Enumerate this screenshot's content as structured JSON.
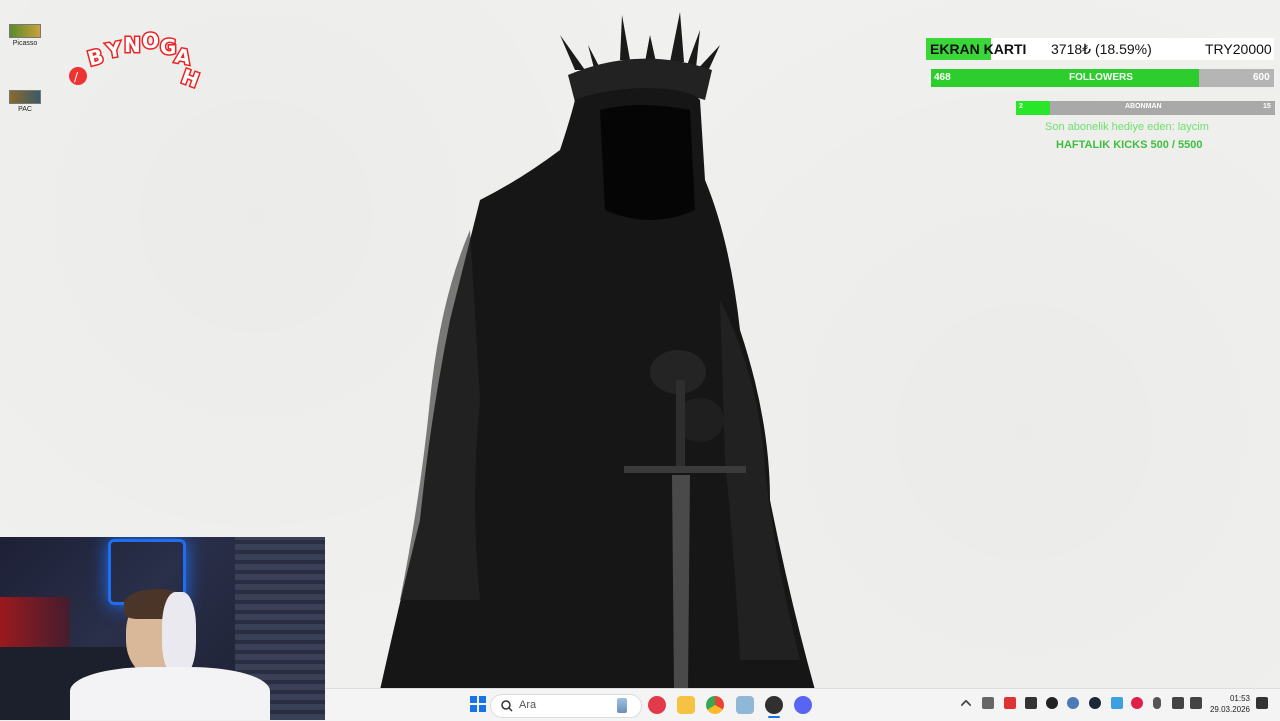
{
  "desktop": {
    "icons": [
      {
        "label": "Picasso"
      },
      {
        "label": "PAC"
      }
    ]
  },
  "logo": {
    "text": "BYNOGA"
  },
  "goal": {
    "label": "EKRAN KARTI",
    "amount": "3718₺ (18.59%)",
    "target": "TRY20000",
    "progress": 0.1859
  },
  "followers": {
    "current": "468",
    "label": "FOLLOWERS",
    "target": "600",
    "progress": 0.78
  },
  "subscribers": {
    "current": "2",
    "label": "ABONMAN",
    "target": "15",
    "progress": 0.133
  },
  "gift_line": "Son abonelik hediye eden: laycim",
  "kicks_line": "HAFTALIK KICKS 500 / 5500",
  "taskbar": {
    "search_placeholder": "Ara",
    "apps": [
      "start-icon",
      "media-player-icon",
      "file-explorer-icon",
      "chrome-icon",
      "settings-icon",
      "obs-icon",
      "discord-icon"
    ]
  },
  "clock": {
    "time": "01:53",
    "date": "29.03.2026"
  },
  "colors": {
    "accent_green": "#2ccd2c",
    "bar_gray": "#b5b5b5"
  }
}
